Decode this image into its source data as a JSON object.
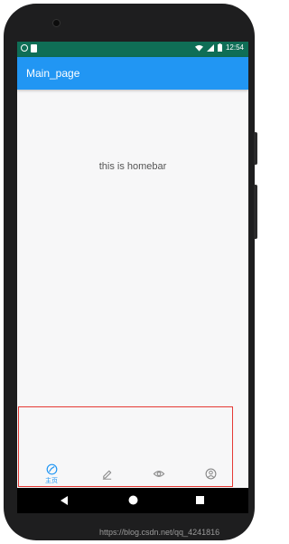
{
  "status_bar": {
    "time": "12:54",
    "left_icons": [
      "circle-icon",
      "sd-card-icon"
    ],
    "right_icons": [
      "wifi-icon",
      "signal-icon",
      "battery-icon"
    ]
  },
  "app_bar": {
    "title": "Main_page"
  },
  "content": {
    "text": "this is homebar"
  },
  "bottom_nav": {
    "items": [
      {
        "label": "主页",
        "icon": "home-icon",
        "active": true
      },
      {
        "label": "",
        "icon": "edit-icon",
        "active": false
      },
      {
        "label": "",
        "icon": "eye-icon",
        "active": false
      },
      {
        "label": "",
        "icon": "profile-icon",
        "active": false
      }
    ]
  },
  "system_nav": {
    "buttons": [
      "back-icon",
      "home-circle-icon",
      "recents-icon"
    ]
  },
  "colors": {
    "status_bar": "#0f6e56",
    "app_bar": "#2196f3",
    "accent": "#2196f3",
    "inactive_icon": "#9e9e9e",
    "annotation": "#e53935"
  },
  "watermark": "https://blog.csdn.net/qq_4241816"
}
